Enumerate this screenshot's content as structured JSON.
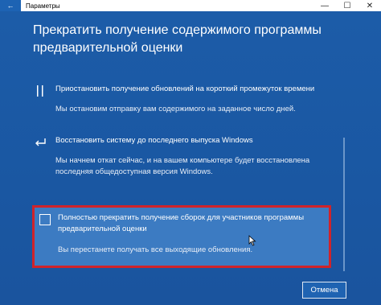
{
  "window": {
    "title": "Параметры",
    "back_icon": "arrow-left-icon",
    "controls": {
      "minimize": "—",
      "maximize": "☐",
      "close": "✕"
    }
  },
  "heading": "Прекратить получение содержимого программы предварительной оценки",
  "options": [
    {
      "icon": "pause-icon",
      "title": "Приостановить получение обновлений на короткий промежуток времени",
      "description": "Мы остановим отправку вам содержимого на заданное число дней."
    },
    {
      "icon": "return-arrow-icon",
      "title": "Восстановить систему до последнего выпуска Windows",
      "description": "Мы начнем откат сейчас, и на вашем компьютере будет восстановлена последняя общедоступная версия Windows."
    },
    {
      "icon": "checkbox-icon",
      "title": "Полностью прекратить получение сборок для участников программы предварительной оценки",
      "description": "Вы перестанете получать все выходящие обновления.",
      "selected": true
    }
  ],
  "buttons": {
    "cancel": "Отмена"
  },
  "colors": {
    "background": "#1b5aa5",
    "highlight_border": "#d0232a"
  }
}
